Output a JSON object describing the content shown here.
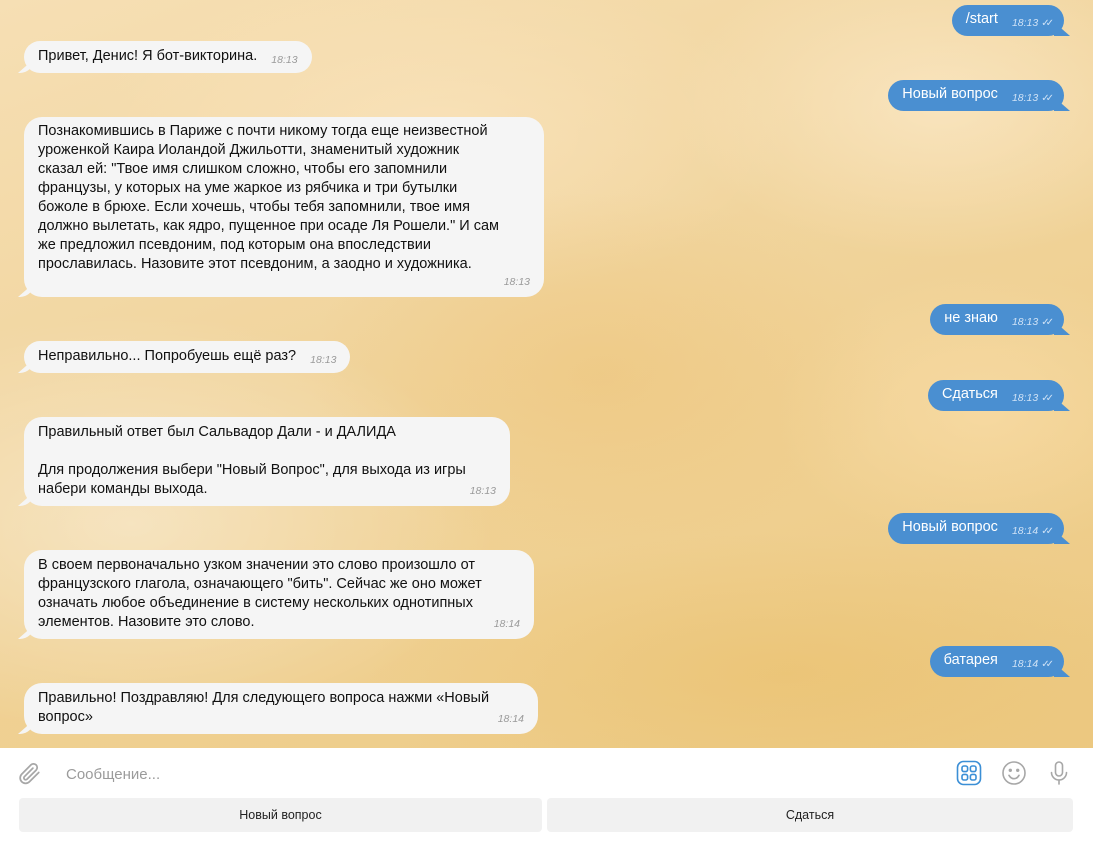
{
  "messages": [
    {
      "text": "/start",
      "time": "18:13"
    },
    {
      "text": "Привет, Денис! Я бот-викторина.",
      "time": "18:13"
    },
    {
      "text": "Новый вопрос",
      "time": "18:13"
    },
    {
      "text": "Познакомившись в Париже с почти никому тогда еще неизвестной\nуроженкой Каира Иоландой Джильотти, знаменитый художник\nсказал ей: \"Твое имя слишком сложно, чтобы его запомнили\nфранцузы, у которых на уме жаркое из рябчика и три бутылки\nбожоле в брюхе. Если хочешь, чтобы тебя запомнили, твое имя\nдолжно вылетать, как ядро, пущенное при осаде Ля Рошели.\" И сам\nже предложил псевдоним, под которым она впоследствии\nпрославилась. Назовите этот псевдоним, а заодно и художника.",
      "time": "18:13"
    },
    {
      "text": "не знаю",
      "time": "18:13"
    },
    {
      "text": "Неправильно... Попробуешь ещё раз?",
      "time": "18:13"
    },
    {
      "text": "Сдаться",
      "time": "18:13"
    },
    {
      "text": "Правильный ответ был Сальвадор Дали - и ДАЛИДА\n\nДля продолжения выбери \"Новый Вопрос\", для выхода из игры\nнабери команды выхода.",
      "time": "18:13"
    },
    {
      "text": "Новый вопрос",
      "time": "18:14"
    },
    {
      "text": "В своем первоначально узком значении это слово произошло от\nфранцузского глагола, означающего \"бить\". Сейчас же оно может\nозначать любое объединение в систему нескольких однотипных\nэлементов. Назовите это слово.",
      "time": "18:14"
    },
    {
      "text": "батарея",
      "time": "18:14"
    },
    {
      "text": "Правильно! Поздравляю! Для следующего вопроса нажми «Новый\nвопрос»",
      "time": "18:14"
    }
  ],
  "composer": {
    "placeholder": "Сообщение..."
  },
  "keyboard": {
    "new_question": "Новый вопрос",
    "give_up": "Сдаться"
  },
  "colors": {
    "outgoing_bubble": "#4a8fd1",
    "incoming_bubble": "#f5f5f5",
    "accent_icon": "#3b8fd6"
  },
  "icons": [
    "paperclip-icon",
    "stickers-grid-icon",
    "emoji-icon",
    "microphone-icon",
    "read-checkmarks-icon"
  ]
}
